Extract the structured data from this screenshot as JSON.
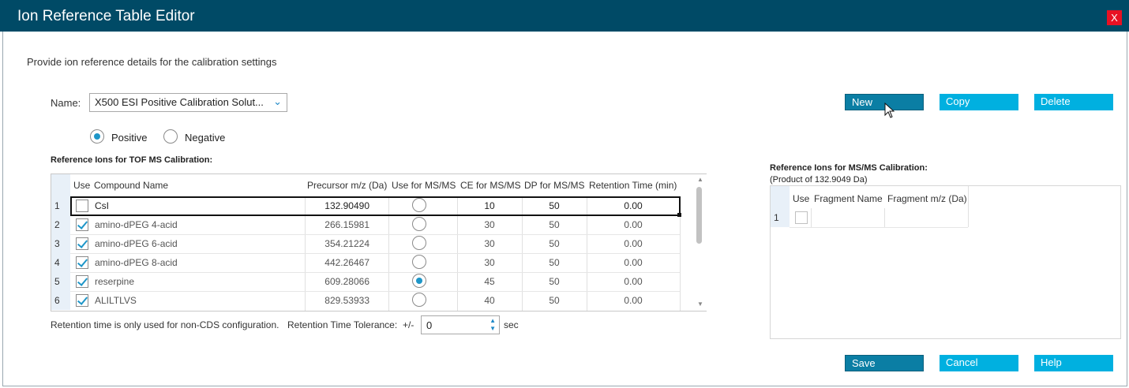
{
  "window": {
    "title": "Ion Reference Table Editor",
    "close_label": "X"
  },
  "subtitle": "Provide ion reference details for the calibration settings",
  "name_field": {
    "label": "Name:",
    "value": "X500 ESI Positive Calibration Solut..."
  },
  "polarity": {
    "options": [
      "Positive",
      "Negative"
    ],
    "selected": "Positive"
  },
  "tof_section": {
    "title": "Reference Ions for TOF MS Calibration:",
    "columns": [
      "Use",
      "Compound Name",
      "Precursor m/z (Da)",
      "Use for MS/MS",
      "CE for MS/MS",
      "DP for MS/MS",
      "Retention Time (min)"
    ],
    "rows": [
      {
        "num": "1",
        "use": false,
        "name": "CsI",
        "precursor": "132.90490",
        "msms": false,
        "ce": "10",
        "dp": "50",
        "rt": "0.00"
      },
      {
        "num": "2",
        "use": true,
        "name": "amino-dPEG 4-acid",
        "precursor": "266.15981",
        "msms": false,
        "ce": "30",
        "dp": "50",
        "rt": "0.00"
      },
      {
        "num": "3",
        "use": true,
        "name": "amino-dPEG 6-acid",
        "precursor": "354.21224",
        "msms": false,
        "ce": "30",
        "dp": "50",
        "rt": "0.00"
      },
      {
        "num": "4",
        "use": true,
        "name": "amino-dPEG 8-acid",
        "precursor": "442.26467",
        "msms": false,
        "ce": "30",
        "dp": "50",
        "rt": "0.00"
      },
      {
        "num": "5",
        "use": true,
        "name": "reserpine",
        "precursor": "609.28066",
        "msms": true,
        "ce": "45",
        "dp": "50",
        "rt": "0.00"
      },
      {
        "num": "6",
        "use": true,
        "name": "ALILTLVS",
        "precursor": "829.53933",
        "msms": false,
        "ce": "40",
        "dp": "50",
        "rt": "0.00"
      }
    ]
  },
  "footer": {
    "note": "Retention time is only used for non-CDS configuration.",
    "tolerance_label": "Retention Time Tolerance:",
    "plus_minus": "+/-",
    "tolerance_value": "0",
    "unit": "sec"
  },
  "buttons": {
    "new": "New",
    "copy": "Copy",
    "delete": "Delete",
    "save": "Save",
    "cancel": "Cancel",
    "help": "Help"
  },
  "msms_section": {
    "title": "Reference Ions for MS/MS Calibration:",
    "subtitle": "(Product of 132.9049 Da)",
    "columns": [
      "Use",
      "Fragment Name",
      "Fragment m/z (Da)"
    ],
    "rows": [
      {
        "num": "1",
        "use": false,
        "name": "",
        "mz": ""
      }
    ]
  },
  "colors": {
    "titlebar": "#004a66",
    "accent": "#00b0e0",
    "selected_button": "#0b7ea4"
  }
}
